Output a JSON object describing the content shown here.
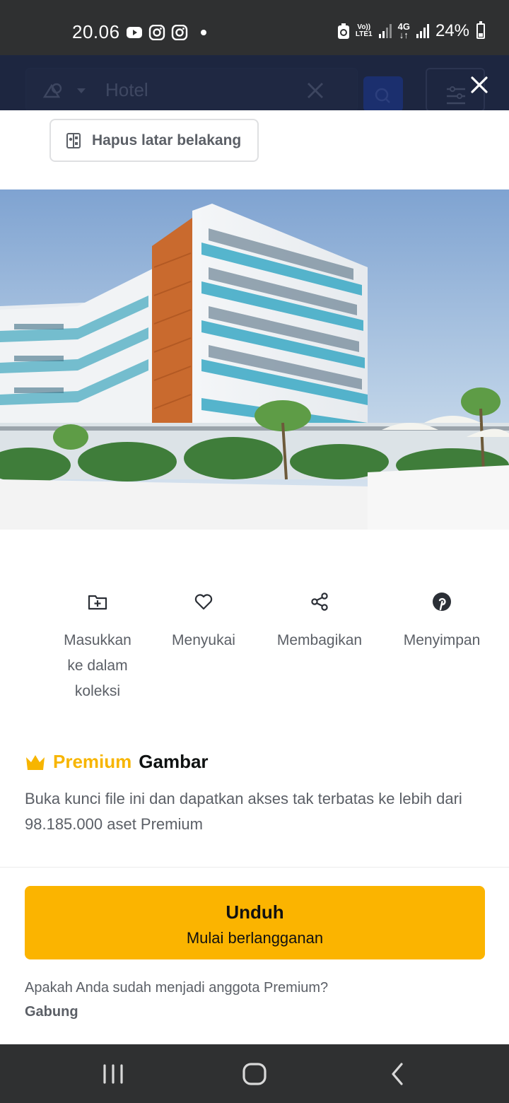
{
  "status_bar": {
    "time": "20.06",
    "network_label_top": "Vo))",
    "network_label_bottom": "LTE1",
    "network_type": "4G",
    "battery": "24%",
    "icons": [
      "youtube-icon",
      "instagram-icon",
      "instagram-icon",
      "recycle-icon",
      "signal-icon",
      "signal-icon",
      "battery-icon"
    ]
  },
  "header": {
    "search_text": "Hotel",
    "icons": [
      "shapes-icon",
      "chevron-down-icon",
      "clear-icon",
      "search-icon",
      "filter-icon",
      "close-icon"
    ]
  },
  "remove_background": {
    "label": "Hapus latar belakang",
    "icon": "remove-background-icon"
  },
  "actions": [
    {
      "icon": "folder-add-icon",
      "label": "Masukkan ke dalam koleksi"
    },
    {
      "icon": "heart-icon",
      "label": "Menyukai"
    },
    {
      "icon": "share-icon",
      "label": "Membagikan"
    },
    {
      "icon": "pinterest-icon",
      "label": "Menyimpan"
    }
  ],
  "premium": {
    "badge_word": "Premium",
    "title_word": "Gambar",
    "description": "Buka kunci file ini dan dapatkan akses tak terbatas ke lebih dari 98.185.000 aset Premium",
    "accent_color": "#f7b500"
  },
  "download": {
    "label": "Unduh",
    "sublabel": "Mulai berlangganan",
    "color": "#fbb400"
  },
  "membership": {
    "question": "Apakah Anda sudah menjadi anggota Premium?",
    "join_label": "Gabung"
  },
  "nav_bar": {
    "icons": [
      "recent-apps-icon",
      "home-icon",
      "back-icon"
    ]
  }
}
